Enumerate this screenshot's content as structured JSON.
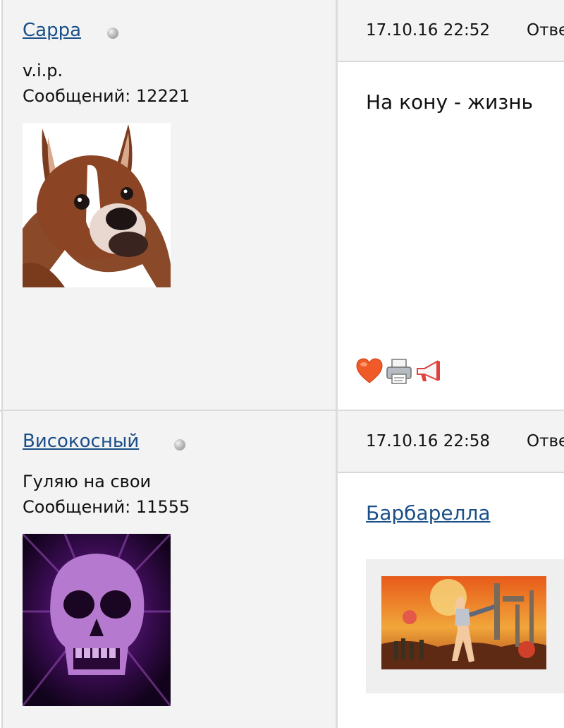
{
  "posts": [
    {
      "username": "Сарра",
      "rank": "v.i.p.",
      "post_count": "Сообщений: 12221",
      "datetime": "17.10.16 22:52",
      "reply_label": "Отве",
      "message": "На кону - жизнь",
      "avatar_icon": "boxer-dog-avatar",
      "actions": [
        "heart-icon",
        "print-icon",
        "megaphone-icon"
      ]
    },
    {
      "username": "Високосный",
      "rank": "Гуляю на свои",
      "post_count": "Сообщений: 11555",
      "datetime": "17.10.16 22:58",
      "reply_label": "Отве",
      "message_link": "Барбарелла",
      "avatar_icon": "purple-skull-avatar",
      "embed_icon": "barbarella-poster-image"
    }
  ],
  "colors": {
    "link": "#1b4f88",
    "sidebar_bg": "#f3f3f3",
    "border": "#d8d8d8",
    "heart": "#f05a28"
  }
}
